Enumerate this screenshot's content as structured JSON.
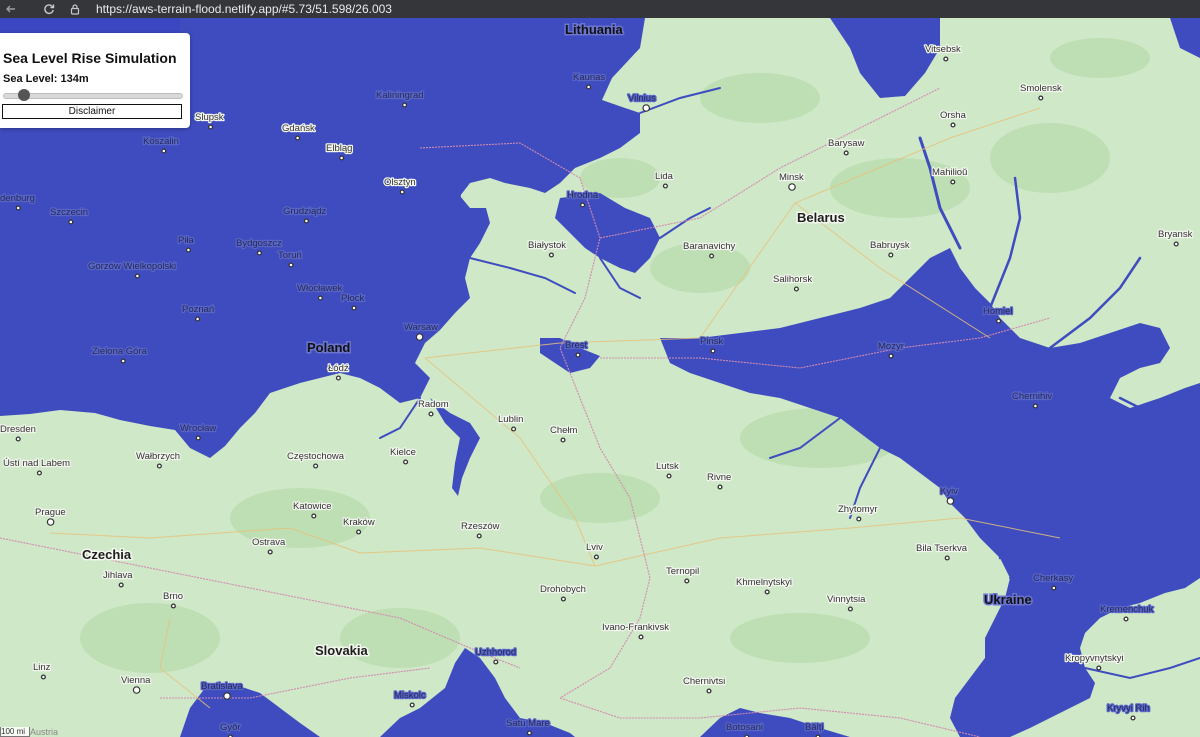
{
  "browser": {
    "back_icon": "arrow-left-icon",
    "reload_icon": "reload-icon",
    "lock_icon": "lock-icon",
    "url": "https://aws-terrain-flood.netlify.app/#5.73/51.598/26.003"
  },
  "panel": {
    "title": "Sea Level Rise Simulation",
    "level_label": "Sea Level: 134m",
    "slider_value_fraction": 0.09,
    "disclaimer_label": "Disclaimer"
  },
  "colors": {
    "water": "#3e4cbf",
    "land": "#cfe8c8"
  },
  "map": {
    "countries": [
      {
        "name": "Lithuania",
        "flooded": true
      },
      {
        "name": "Belarus",
        "flooded": false
      },
      {
        "name": "Poland",
        "flooded": true
      },
      {
        "name": "Czechia",
        "flooded": false
      },
      {
        "name": "Slovakia",
        "flooded": false
      },
      {
        "name": "Ukraine",
        "flooded": true
      }
    ],
    "cities": [
      {
        "name": "Vitsebsk",
        "flooded": false
      },
      {
        "name": "Kaunas",
        "flooded": true
      },
      {
        "name": "Smolensk",
        "flooded": false
      },
      {
        "name": "Kaliningrad",
        "flooded": true
      },
      {
        "name": "Vilnius",
        "flooded": true
      },
      {
        "name": "Slupsk",
        "flooded": false
      },
      {
        "name": "Gdańsk",
        "flooded": false
      },
      {
        "name": "Orsha",
        "flooded": false
      },
      {
        "name": "Koszalin",
        "flooded": true
      },
      {
        "name": "Elbląg",
        "flooded": false
      },
      {
        "name": "Barysaw",
        "flooded": false
      },
      {
        "name": "Minsk",
        "flooded": false
      },
      {
        "name": "Lida",
        "flooded": false
      },
      {
        "name": "Mahilioŭ",
        "flooded": false
      },
      {
        "name": "Olsztyn",
        "flooded": false
      },
      {
        "name": "Hrodna",
        "flooded": true
      },
      {
        "name": "denburg",
        "flooded": true
      },
      {
        "name": "Szczecin",
        "flooded": true
      },
      {
        "name": "Grudziądz",
        "flooded": true
      },
      {
        "name": "Piła",
        "flooded": true
      },
      {
        "name": "Bydgoszcz",
        "flooded": true
      },
      {
        "name": "Białystok",
        "flooded": false
      },
      {
        "name": "Baranavichy",
        "flooded": false
      },
      {
        "name": "Babruysk",
        "flooded": false
      },
      {
        "name": "Bryansk",
        "flooded": false
      },
      {
        "name": "Toruń",
        "flooded": true
      },
      {
        "name": "Gorzów Wielkopolski",
        "flooded": true
      },
      {
        "name": "Salihorsk",
        "flooded": false
      },
      {
        "name": "Włocławek",
        "flooded": true
      },
      {
        "name": "Płock",
        "flooded": true
      },
      {
        "name": "Poznań",
        "flooded": true
      },
      {
        "name": "Homiel",
        "flooded": true
      },
      {
        "name": "Warsaw",
        "flooded": true
      },
      {
        "name": "Brest",
        "flooded": true
      },
      {
        "name": "Pinsk",
        "flooded": true
      },
      {
        "name": "Mozyr",
        "flooded": true
      },
      {
        "name": "Zielona Góra",
        "flooded": true
      },
      {
        "name": "Łódź",
        "flooded": false
      },
      {
        "name": "Chernihiv",
        "flooded": true
      },
      {
        "name": "Radom",
        "flooded": false
      },
      {
        "name": "Lublin",
        "flooded": false
      },
      {
        "name": "Dresden",
        "flooded": false
      },
      {
        "name": "Wrocław",
        "flooded": true
      },
      {
        "name": "Chełm",
        "flooded": false
      },
      {
        "name": "Wałbrzych",
        "flooded": false
      },
      {
        "name": "Kielce",
        "flooded": false
      },
      {
        "name": "Częstochowa",
        "flooded": false
      },
      {
        "name": "Ústí nad Labem",
        "flooded": false
      },
      {
        "name": "Lutsk",
        "flooded": false
      },
      {
        "name": "Rivne",
        "flooded": false
      },
      {
        "name": "Kyiv",
        "flooded": true
      },
      {
        "name": "Katowice",
        "flooded": false
      },
      {
        "name": "Zhytomyr",
        "flooded": false
      },
      {
        "name": "Prague",
        "flooded": false
      },
      {
        "name": "Kraków",
        "flooded": false
      },
      {
        "name": "Rzeszów",
        "flooded": false
      },
      {
        "name": "Ostrava",
        "flooded": false
      },
      {
        "name": "Bila Tserkva",
        "flooded": false
      },
      {
        "name": "Lviv",
        "flooded": false
      },
      {
        "name": "Jihlava",
        "flooded": false
      },
      {
        "name": "Ternopil",
        "flooded": false
      },
      {
        "name": "Khmelnytskyi",
        "flooded": false
      },
      {
        "name": "Cherkasy",
        "flooded": true
      },
      {
        "name": "Drohobych",
        "flooded": false
      },
      {
        "name": "Brno",
        "flooded": false
      },
      {
        "name": "Vinnytsia",
        "flooded": false
      },
      {
        "name": "Kremenchuk",
        "flooded": true
      },
      {
        "name": "Ivano-Frankivsk",
        "flooded": false
      },
      {
        "name": "Uzhhorod",
        "flooded": true
      },
      {
        "name": "Kropyvnytskyi",
        "flooded": false
      },
      {
        "name": "Linz",
        "flooded": false
      },
      {
        "name": "Vienna",
        "flooded": false
      },
      {
        "name": "Chernivtsi",
        "flooded": false
      },
      {
        "name": "Bratislava",
        "flooded": true
      },
      {
        "name": "Miskolc",
        "flooded": true
      },
      {
        "name": "Kryvyi Rih",
        "flooded": true
      },
      {
        "name": "Győr",
        "flooded": true
      },
      {
        "name": "Satu Mare",
        "flooded": true
      },
      {
        "name": "Botosani",
        "flooded": true
      },
      {
        "name": "Bălți",
        "flooded": true
      }
    ]
  },
  "footer": {
    "scale_text": "100 mi",
    "attribution_partial": "Austria"
  }
}
